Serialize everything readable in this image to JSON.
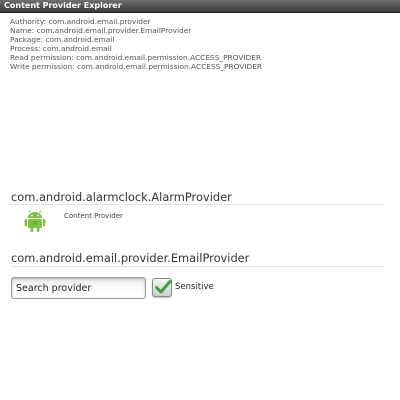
{
  "app": {
    "title": "Content Provider Explorer"
  },
  "details": {
    "authority": "Authority: com.android.email.provider",
    "name": "Name: com.android.email.provider.EmailProvider",
    "package": "Package: com.android.email",
    "process": "Process: com.android.email",
    "read_permission": "Read permission: com.android.email.permission.ACCESS_PROVIDER",
    "write_permission": "Write permission: com.android.email.permission.ACCESS_PROVIDER"
  },
  "providers": [
    {
      "name": "com.android.alarmclock.AlarmProvider",
      "type": "Content Provider",
      "icon": "android-robot-icon"
    },
    {
      "name": "com.android.email.provider.EmailProvider"
    }
  ],
  "search": {
    "value": "Search provider",
    "placeholder": "Search provider"
  },
  "sensitive": {
    "label": "Sensitive",
    "checked": true
  },
  "colors": {
    "accent": "#7dc242",
    "check": "#3aa23a",
    "titlebar": "#4a4a4a"
  }
}
